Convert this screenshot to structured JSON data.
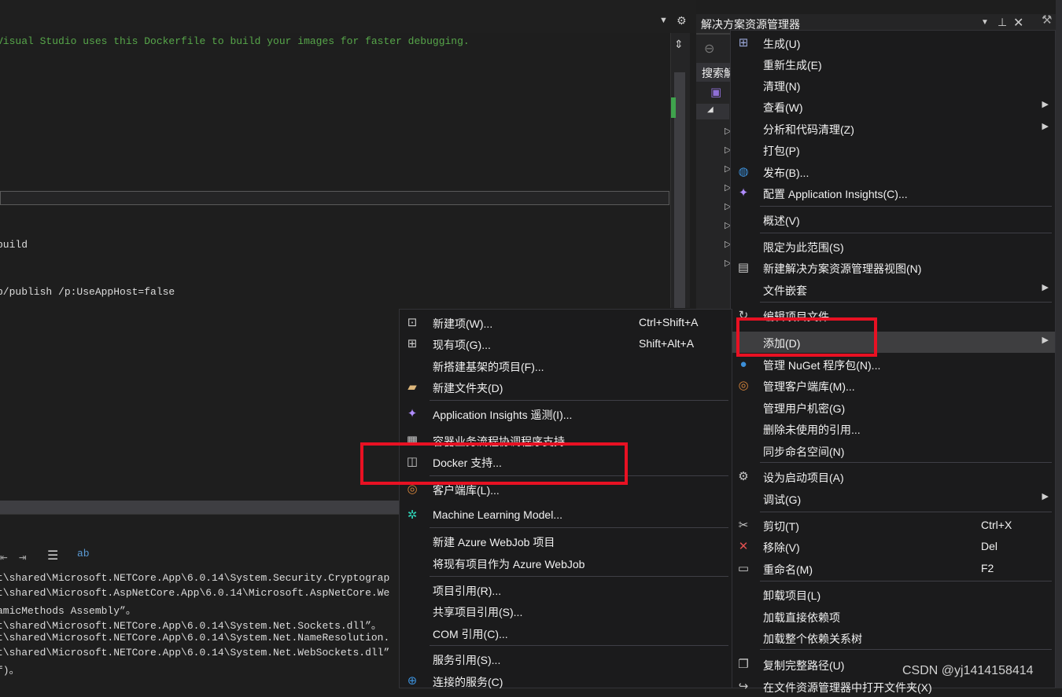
{
  "editor": {
    "comment_line": "Visual Studio uses this Dockerfile to build your images for faster debugging."
  },
  "output": {
    "lines": [
      "build",
      "p/publish /p:UseAppHost=false"
    ]
  },
  "bottom_output": {
    "lines": [
      "t\\shared\\Microsoft.NETCore.App\\6.0.14\\System.Security.Cryptograp",
      "t\\shared\\Microsoft.AspNetCore.App\\6.0.14\\Microsoft.AspNetCore.We",
      "amicMethods Assembly”。",
      "t\\shared\\Microsoft.NETCore.App\\6.0.14\\System.Net.Sockets.dll”。",
      "t\\shared\\Microsoft.NETCore.App\\6.0.14\\System.Net.NameResolution.",
      "t\\shared\\Microsoft.NETCore.App\\6.0.14\\System.Net.WebSockets.dll”",
      "f)。"
    ]
  },
  "solution_explorer": {
    "title": "解决方案资源管理器",
    "search_label": "搜索解"
  },
  "project_menu": {
    "items": [
      {
        "label": "生成(U)",
        "icon": "build-icon"
      },
      {
        "label": "重新生成(E)"
      },
      {
        "label": "清理(N)"
      },
      {
        "label": "查看(W)",
        "submenu": true
      },
      {
        "label": "分析和代码清理(Z)",
        "submenu": true
      },
      {
        "label": "打包(P)"
      },
      {
        "label": "发布(B)...",
        "icon": "publish-globe-icon"
      },
      {
        "label": "配置 Application Insights(C)...",
        "icon": "app-insights-icon"
      },
      {
        "label": "概述(V)"
      },
      {
        "label": "限定为此范围(S)"
      },
      {
        "label": "新建解决方案资源管理器视图(N)",
        "icon": "new-view-icon"
      },
      {
        "label": "文件嵌套",
        "submenu": true
      },
      {
        "label": "编辑项目文件",
        "icon": "edit-icon"
      },
      {
        "label": "添加(D)",
        "submenu": true,
        "highlighted": true
      },
      {
        "label": "管理 NuGet 程序包(N)...",
        "icon": "nuget-icon"
      },
      {
        "label": "管理客户端库(M)...",
        "icon": "client-lib-icon"
      },
      {
        "label": "管理用户机密(G)"
      },
      {
        "label": "删除未使用的引用..."
      },
      {
        "label": "同步命名空间(N)"
      },
      {
        "label": "设为启动项目(A)",
        "icon": "gear-icon"
      },
      {
        "label": "调试(G)",
        "submenu": true
      },
      {
        "label": "剪切(T)",
        "shortcut": "Ctrl+X",
        "icon": "scissors-icon"
      },
      {
        "label": "移除(V)",
        "shortcut": "Del",
        "icon": "remove-x-icon"
      },
      {
        "label": "重命名(M)",
        "shortcut": "F2",
        "icon": "rename-icon"
      },
      {
        "label": "卸载项目(L)"
      },
      {
        "label": "加载直接依赖项"
      },
      {
        "label": "加载整个依赖关系树"
      },
      {
        "label": "复制完整路径(U)",
        "icon": "copy-icon"
      },
      {
        "label": "在文件资源管理器中打开文件夹(X)",
        "icon": "open-folder-icon"
      }
    ]
  },
  "add_menu": {
    "items": [
      {
        "label": "新建项(W)...",
        "shortcut": "Ctrl+Shift+A",
        "icon": "new-item-icon"
      },
      {
        "label": "现有项(G)...",
        "shortcut": "Shift+Alt+A",
        "icon": "existing-item-icon"
      },
      {
        "label": "新搭建基架的项目(F)..."
      },
      {
        "label": "新建文件夹(D)",
        "icon": "new-folder-icon"
      },
      {
        "label": "Application Insights 遥测(I)...",
        "icon": "app-insights-icon"
      },
      {
        "label": "容器业务流程协调程序支持...",
        "icon": "container-icon"
      },
      {
        "label": "Docker 支持...",
        "icon": "docker-icon"
      },
      {
        "label": "客户端库(L)...",
        "icon": "client-lib-icon"
      },
      {
        "label": "Machine Learning Model...",
        "icon": "ml-gear-icon"
      },
      {
        "label": "新建 Azure WebJob 项目"
      },
      {
        "label": "将现有项目作为 Azure WebJob"
      },
      {
        "label": "项目引用(R)..."
      },
      {
        "label": "共享项目引用(S)..."
      },
      {
        "label": "COM 引用(C)..."
      },
      {
        "label": "服务引用(S)..."
      },
      {
        "label": "连接的服务(C)",
        "icon": "connected-service-icon"
      }
    ]
  },
  "watermark": "CSDN @yj1414158414",
  "colors": {
    "highlight_box": "#e81123",
    "menu_bg": "#1b1b1c",
    "comment_green": "#57a64a"
  }
}
